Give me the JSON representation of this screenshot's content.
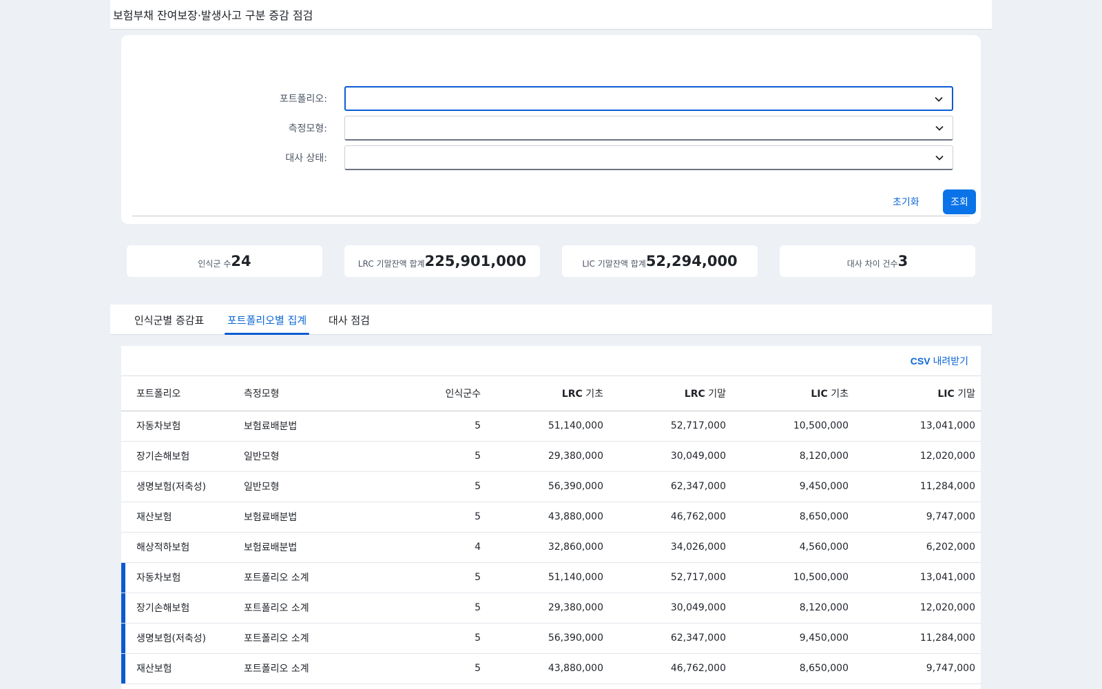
{
  "window": {
    "title": "보험부채 잔여보장·발생사고 구분 증감 점검"
  },
  "filters": {
    "portfolio_label": "포트폴리오:",
    "model_label": "측정모형:",
    "recon_label": "대사 상태:",
    "reset_label": "초기화",
    "search_label": "조회"
  },
  "kpis": [
    {
      "label": "인식군 수",
      "value": "24"
    },
    {
      "label": "LRC 기말잔액 합계",
      "value": "225,901,000"
    },
    {
      "label": "LIC 기말잔액 합계",
      "value": "52,294,000"
    },
    {
      "label": "대사 차이 건수",
      "value": "3"
    }
  ],
  "tabs": [
    {
      "label": "인식군별 증감표",
      "active": false
    },
    {
      "label": "포트폴리오별 집계",
      "active": true
    },
    {
      "label": "대사 점검",
      "active": false
    }
  ],
  "table": {
    "csv_prefix": "CSV",
    "csv_suffix": " 내려받기",
    "columns": [
      {
        "label": "포트폴리오"
      },
      {
        "label": "측정모형"
      },
      {
        "label": "인식군수"
      },
      {
        "prefix": "LRC",
        "suffix": " 기초"
      },
      {
        "prefix": "LRC",
        "suffix": " 기말"
      },
      {
        "prefix": "LIC",
        "suffix": " 기초"
      },
      {
        "prefix": "LIC",
        "suffix": " 기말"
      }
    ],
    "rows": [
      {
        "portfolio": "자동차보험",
        "model": "보험료배분법",
        "count": "5",
        "lrc_begin": "51,140,000",
        "lrc_end": "52,717,000",
        "lic_begin": "10,500,000",
        "lic_end": "13,041,000",
        "subtotal": false
      },
      {
        "portfolio": "장기손해보험",
        "model": "일반모형",
        "count": "5",
        "lrc_begin": "29,380,000",
        "lrc_end": "30,049,000",
        "lic_begin": "8,120,000",
        "lic_end": "12,020,000",
        "subtotal": false
      },
      {
        "portfolio": "생명보험(저축성)",
        "model": "일반모형",
        "count": "5",
        "lrc_begin": "56,390,000",
        "lrc_end": "62,347,000",
        "lic_begin": "9,450,000",
        "lic_end": "11,284,000",
        "subtotal": false
      },
      {
        "portfolio": "재산보험",
        "model": "보험료배분법",
        "count": "5",
        "lrc_begin": "43,880,000",
        "lrc_end": "46,762,000",
        "lic_begin": "8,650,000",
        "lic_end": "9,747,000",
        "subtotal": false
      },
      {
        "portfolio": "해상적하보험",
        "model": "보험료배분법",
        "count": "4",
        "lrc_begin": "32,860,000",
        "lrc_end": "34,026,000",
        "lic_begin": "4,560,000",
        "lic_end": "6,202,000",
        "subtotal": false
      },
      {
        "portfolio": "자동차보험",
        "model": "포트폴리오 소계",
        "count": "5",
        "lrc_begin": "51,140,000",
        "lrc_end": "52,717,000",
        "lic_begin": "10,500,000",
        "lic_end": "13,041,000",
        "subtotal": true
      },
      {
        "portfolio": "장기손해보험",
        "model": "포트폴리오 소계",
        "count": "5",
        "lrc_begin": "29,380,000",
        "lrc_end": "30,049,000",
        "lic_begin": "8,120,000",
        "lic_end": "12,020,000",
        "subtotal": true
      },
      {
        "portfolio": "생명보험(저축성)",
        "model": "포트폴리오 소계",
        "count": "5",
        "lrc_begin": "56,390,000",
        "lrc_end": "62,347,000",
        "lic_begin": "9,450,000",
        "lic_end": "11,284,000",
        "subtotal": true
      },
      {
        "portfolio": "재산보험",
        "model": "포트폴리오 소계",
        "count": "5",
        "lrc_begin": "43,880,000",
        "lrc_end": "46,762,000",
        "lic_begin": "8,650,000",
        "lic_end": "9,747,000",
        "subtotal": true
      }
    ]
  },
  "colors": {
    "accent": "#0a5bd1",
    "primary_button": "#0a73e8",
    "background": "#edf0f5"
  },
  "icons": {
    "select_chevron": "chevron-down-icon"
  }
}
